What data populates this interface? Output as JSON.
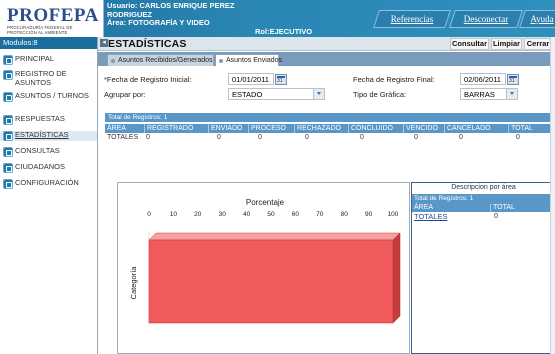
{
  "header": {
    "logo": "PROFEPA",
    "logo_sub1": "PROCURADURÍA FEDERAL DE",
    "logo_sub2": "PROTECCIÓN AL AMBIENTE",
    "user_line1": "Usuario: CARLOS ENRIQUE PEREZ",
    "user_line2": "RODRIGUEZ",
    "user_line3": "Área: FOTOGRAFÍA Y VIDEO",
    "rol": "Rol:EJECUTIVO",
    "nav": [
      "Referencias",
      "Desconectar",
      "Ayuda"
    ]
  },
  "sidebar": {
    "modulos": "Modulos:8",
    "items": [
      {
        "label": "PRINCIPAL",
        "icon": "principal-icon"
      },
      {
        "label": "REGISTRO DE ASUNTOS",
        "icon": "registro-icon"
      },
      {
        "label": "ASUNTOS / TURNOS",
        "icon": "asuntos-icon"
      },
      {
        "label": "RESPUESTAS",
        "icon": "respuestas-icon"
      },
      {
        "label": "ESTADÍSTICAS",
        "icon": "estadisticas-icon"
      },
      {
        "label": "CONSULTAS",
        "icon": "consultas-icon"
      },
      {
        "label": "CIUDADANOS",
        "icon": "ciudadanos-icon"
      },
      {
        "label": "CONFIGURACIÓN",
        "icon": "configuracion-icon"
      }
    ],
    "active_index": 4
  },
  "page": {
    "title": "ESTADÍSTICAS",
    "buttons": {
      "consultar": "Consultar",
      "limpiar": "Limpiar",
      "cerrar": "Cerrar"
    },
    "tabs": [
      "Asuntos Recibidos/Generados",
      "Asuntos Enviados"
    ],
    "active_tab": 1
  },
  "form": {
    "fecha_inicial_label": "*Fecha de Registro Inicial:",
    "fecha_inicial": "01/01/2011",
    "fecha_final_label": "Fecha de Registro Final:",
    "fecha_final": "02/06/2011",
    "agrupar_label": "Agrupar por:",
    "agrupar_value": "ESTADO",
    "tipo_label": "Tipo de Gráfica:",
    "tipo_value": "BARRAS"
  },
  "results": {
    "total_label": "Total de Registros: 1",
    "columns": [
      "ÁREA",
      "REGISTRADO",
      "ENVIADO",
      "PROCESO",
      "RECHAZADO",
      "CONCLUIDO",
      "VENCIDO",
      "CANCELADO",
      "TOTAL"
    ],
    "row": [
      "TOTALES",
      "0",
      "0",
      "0",
      "0",
      "0",
      "0",
      "0",
      "0"
    ]
  },
  "chart_data": {
    "type": "bar",
    "orientation": "horizontal",
    "title": "Porcentaje",
    "xlabel": "",
    "ylabel": "Categoría",
    "xlim": [
      0,
      100
    ],
    "xticks": [
      0,
      10,
      20,
      30,
      40,
      50,
      60,
      70,
      80,
      90,
      100
    ],
    "categories": [
      ""
    ],
    "values": [
      100
    ],
    "bar_color": "#f05a5a",
    "grid": false
  },
  "description": {
    "title": "Descripcion por área",
    "total_label": "Total de Registros: 1",
    "columns": [
      "ÁREA",
      "TOTAL"
    ],
    "row": [
      "TOTALES",
      "0"
    ]
  },
  "colors": {
    "header_blue": "#2a86b4",
    "table_blue": "#5a97c9",
    "bar_red": "#f05a5a"
  }
}
